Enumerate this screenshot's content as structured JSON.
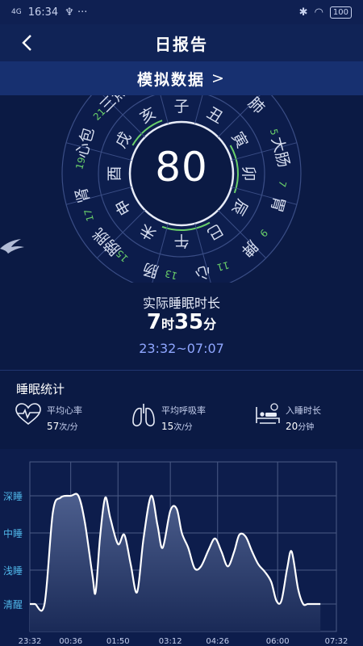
{
  "status_bar": {
    "network": "4G",
    "time": "16:34",
    "icons_left": "♆ ···",
    "battery": "100"
  },
  "header": {
    "title": "日报告"
  },
  "sim_banner": {
    "label": "模拟数据",
    "chevron": ">"
  },
  "dial": {
    "score": "80",
    "branches": [
      "子",
      "丑",
      "寅",
      "卯",
      "辰",
      "巳",
      "午",
      "未",
      "申",
      "酉",
      "戌",
      "亥"
    ],
    "organs": [
      {
        "label": "肝",
        "num": "1"
      },
      {
        "label": "肺",
        "num": "3"
      },
      {
        "label": "大肠",
        "num": "5"
      },
      {
        "label": "胃",
        "num": "7"
      },
      {
        "label": "脾",
        "num": "9"
      },
      {
        "label": "心",
        "num": "11"
      },
      {
        "label": "肠",
        "num": "13"
      },
      {
        "label": "膀胱",
        "num": "15"
      },
      {
        "label": "肾",
        "num": "17"
      },
      {
        "label": "心包",
        "num": "19"
      },
      {
        "label": "三焦",
        "num": "21"
      },
      {
        "label": "胆",
        "num": "23"
      }
    ]
  },
  "sleep": {
    "label": "实际睡眠时长",
    "hours": "7",
    "hours_unit": "时",
    "minutes": "35",
    "minutes_unit": "分",
    "range": "23:32~07:07"
  },
  "stats": {
    "title": "睡眠统计",
    "heart_rate": {
      "label": "平均心率",
      "value": "57",
      "unit": "次/分",
      "icon": "heart-pulse-icon"
    },
    "breath_rate": {
      "label": "平均呼吸率",
      "value": "15",
      "unit": "次/分",
      "icon": "lungs-icon"
    },
    "sleep_onset": {
      "label": "入睡时长",
      "value": "20",
      "unit": "分钟",
      "icon": "bed-icon"
    }
  },
  "chart_data": {
    "type": "area",
    "y_levels": [
      "清醒",
      "浅睡",
      "中睡",
      "深睡"
    ],
    "x_ticks": [
      "23:32",
      "00:36",
      "01:50",
      "03:12",
      "04:26",
      "06:00",
      "07:32"
    ],
    "colors": {
      "line": "#ffffff",
      "fill_top": "#4d5f8e",
      "fill_bottom": "#1a2a57",
      "grid": "#4b5b86",
      "ylabel": "#4fb6e8"
    },
    "series": [
      {
        "x": [
          "23:32",
          "23:40",
          "23:55",
          "00:08",
          "00:20",
          "00:36",
          "00:48",
          "00:58",
          "01:10",
          "01:15",
          "01:22",
          "01:30",
          "01:38",
          "01:50",
          "02:00",
          "02:10",
          "02:20",
          "02:30",
          "02:42",
          "02:52",
          "03:00",
          "03:12",
          "03:22",
          "03:30",
          "03:40",
          "03:50",
          "04:00",
          "04:12",
          "04:22",
          "04:32",
          "04:42",
          "04:52",
          "05:00",
          "05:10",
          "05:20",
          "05:30",
          "05:40",
          "05:50",
          "05:58",
          "06:06",
          "06:15",
          "06:22",
          "06:32",
          "06:40",
          "06:47",
          "06:54",
          "07:02",
          "07:07"
        ],
        "y": [
          0,
          0,
          0,
          2.55,
          2.95,
          3.0,
          3.0,
          2.3,
          0.85,
          0.35,
          1.9,
          2.95,
          2.4,
          1.7,
          1.95,
          1.15,
          0.35,
          1.85,
          3.0,
          2.2,
          1.6,
          2.6,
          2.65,
          2.0,
          1.6,
          1.05,
          1.1,
          1.55,
          1.85,
          1.5,
          1.1,
          1.5,
          1.95,
          1.9,
          1.5,
          1.15,
          0.95,
          0.65,
          0.1,
          0.1,
          1.05,
          1.5,
          0.45,
          0,
          0,
          0,
          0,
          0
        ]
      }
    ]
  }
}
